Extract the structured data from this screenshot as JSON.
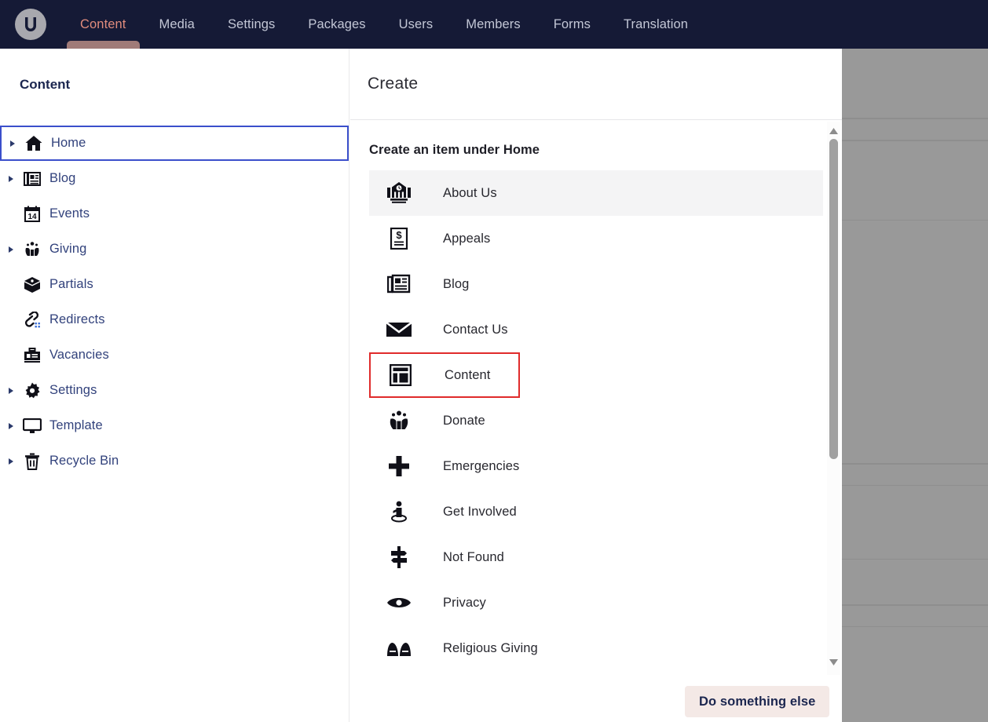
{
  "topnav": {
    "logo_name": "umbraco-logo",
    "items": [
      {
        "label": "Content",
        "active": true
      },
      {
        "label": "Media",
        "active": false
      },
      {
        "label": "Settings",
        "active": false
      },
      {
        "label": "Packages",
        "active": false
      },
      {
        "label": "Users",
        "active": false
      },
      {
        "label": "Members",
        "active": false
      },
      {
        "label": "Forms",
        "active": false
      },
      {
        "label": "Translation",
        "active": false
      }
    ],
    "background": "#151a36",
    "active_color": "#e08c7d",
    "inactive_color": "#c3c7d6",
    "indicator_color": "#a07b78"
  },
  "sidebar": {
    "title": "Content",
    "focus_outline_color": "#3b4fcb",
    "label_color": "#32427c",
    "items": [
      {
        "label": "Home",
        "icon": "home-icon",
        "expandable": true,
        "focused": true
      },
      {
        "label": "Blog",
        "icon": "newspaper-icon",
        "expandable": true,
        "focused": false
      },
      {
        "label": "Events",
        "icon": "calendar-icon",
        "expandable": false,
        "focused": false
      },
      {
        "label": "Giving",
        "icon": "hands-heart-icon",
        "expandable": true,
        "focused": false
      },
      {
        "label": "Partials",
        "icon": "box-icon",
        "expandable": false,
        "focused": false
      },
      {
        "label": "Redirects",
        "icon": "link-icon",
        "expandable": false,
        "focused": false
      },
      {
        "label": "Vacancies",
        "icon": "briefcase-icon",
        "expandable": false,
        "focused": false
      },
      {
        "label": "Settings",
        "icon": "gear-icon",
        "expandable": true,
        "focused": false
      },
      {
        "label": "Template",
        "icon": "monitor-icon",
        "expandable": true,
        "focused": false
      },
      {
        "label": "Recycle Bin",
        "icon": "trash-icon",
        "expandable": true,
        "focused": false
      }
    ]
  },
  "panel": {
    "title": "Create",
    "subtitle": "Create an item under Home",
    "hover_background": "#f4f4f5",
    "target_outline_color": "#e02b2b",
    "items": [
      {
        "label": "About Us",
        "icon": "bank-building-icon",
        "state": "hovered"
      },
      {
        "label": "Appeals",
        "icon": "money-document-icon",
        "state": "normal"
      },
      {
        "label": "Blog",
        "icon": "newspaper-icon",
        "state": "normal"
      },
      {
        "label": "Contact Us",
        "icon": "envelope-icon",
        "state": "normal"
      },
      {
        "label": "Content",
        "icon": "layout-icon",
        "state": "target"
      },
      {
        "label": "Donate",
        "icon": "hands-heart-icon",
        "state": "normal"
      },
      {
        "label": "Emergencies",
        "icon": "plus-cross-icon",
        "state": "normal"
      },
      {
        "label": "Get Involved",
        "icon": "person-pin-icon",
        "state": "normal"
      },
      {
        "label": "Not Found",
        "icon": "signpost-icon",
        "state": "normal"
      },
      {
        "label": "Privacy",
        "icon": "eye-icon",
        "state": "normal"
      },
      {
        "label": "Religious Giving",
        "icon": "praying-hands-icon",
        "state": "normal"
      }
    ]
  },
  "scrollbar": {
    "up_arrow": "scroll-up-arrow",
    "down_arrow": "scroll-down-arrow",
    "thumb_color": "#a0a0a0"
  },
  "footer": {
    "button_label": "Do something else",
    "button_background": "#f4e9e6",
    "button_text_color": "#1b264f"
  },
  "overlay": {
    "background": "#999999"
  }
}
